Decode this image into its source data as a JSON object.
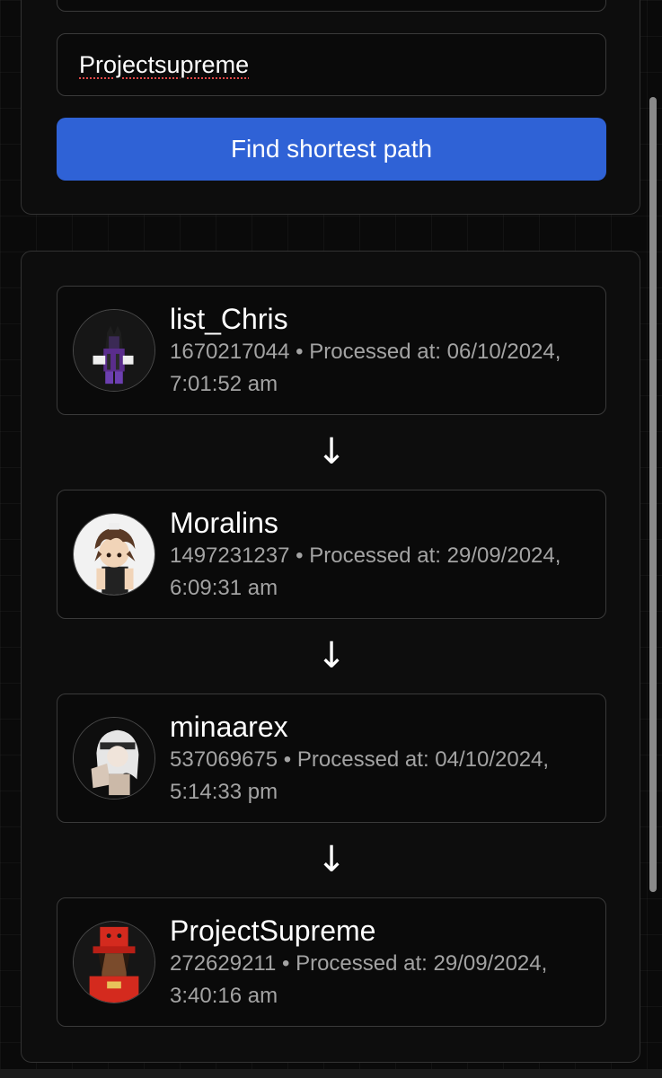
{
  "form": {
    "target_value": "Projectsupreme",
    "find_button_label": "Find shortest path"
  },
  "path": [
    {
      "name": "list_Chris",
      "meta": "1670217044 • Processed at: 06/10/2024, 7:01:52 am"
    },
    {
      "name": "Moralins",
      "meta": "1497231237 • Processed at: 29/09/2024, 6:09:31 am"
    },
    {
      "name": "minaarex",
      "meta": "537069675 • Processed at: 04/10/2024, 5:14:33 pm"
    },
    {
      "name": "ProjectSupreme",
      "meta": "272629211 • Processed at: 29/09/2024, 3:40:16 am"
    }
  ],
  "arrow_glyph": "↓",
  "icons": {
    "arrow": "arrow-down-icon",
    "avatar": "avatar-image"
  },
  "colors": {
    "background": "#0a0a0a",
    "panel": "#0d0d0d",
    "border": "#3a3a3a",
    "accent": "#2f62d6",
    "muted_text": "#a3a3a3",
    "spellcheck_underline": "#e04848"
  }
}
